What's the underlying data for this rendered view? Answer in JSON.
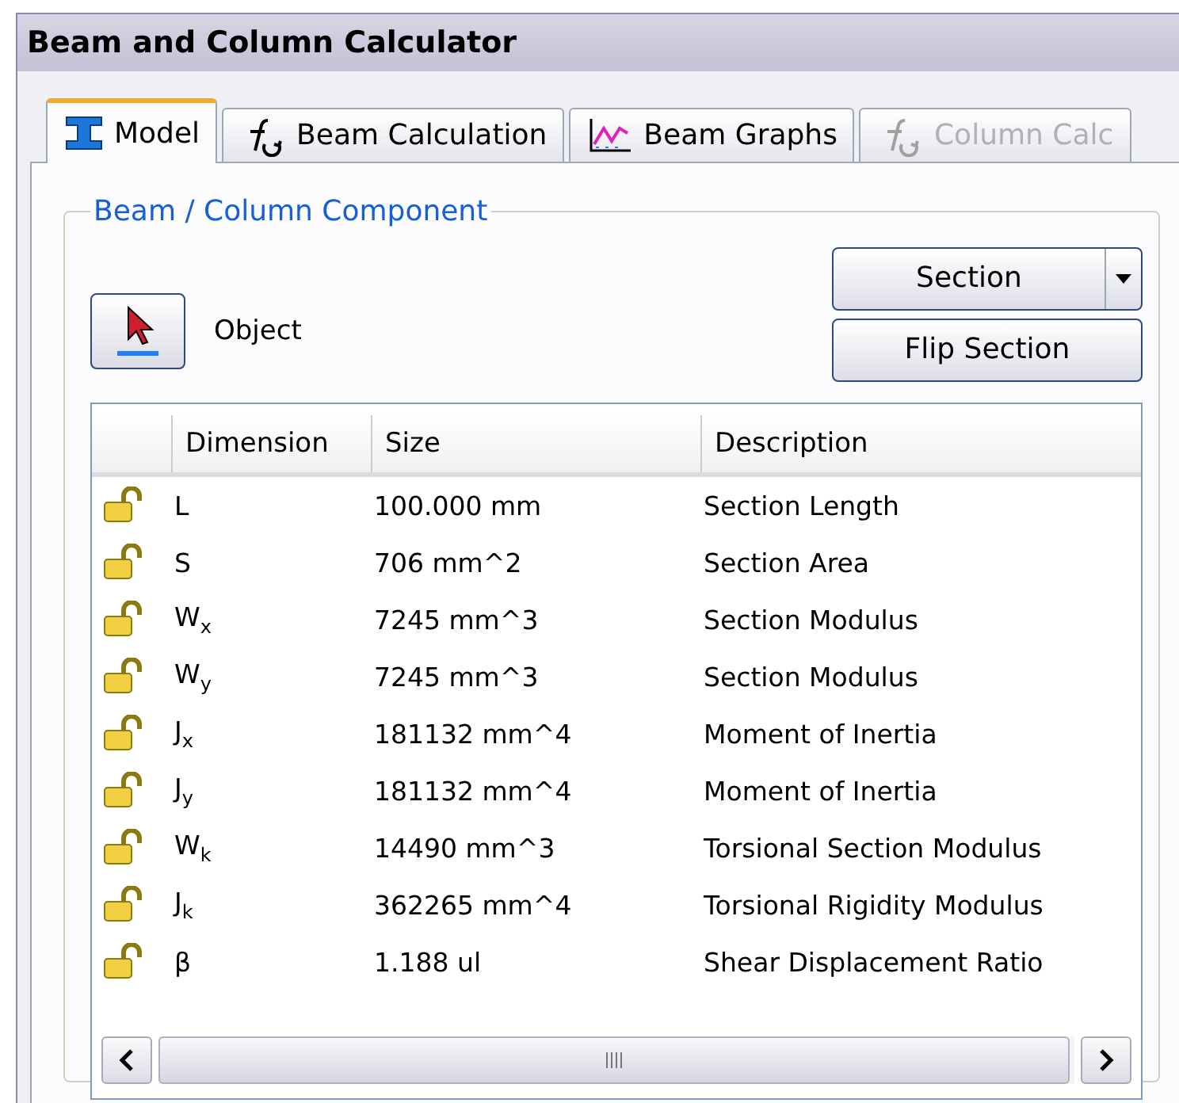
{
  "window": {
    "title": "Beam and Column Calculator"
  },
  "tabs": [
    {
      "label": "Model",
      "kind": "beam",
      "selected": true,
      "disabled": false
    },
    {
      "label": "Beam Calculation",
      "kind": "formula",
      "selected": false,
      "disabled": false
    },
    {
      "label": "Beam Graphs",
      "kind": "graph",
      "selected": false,
      "disabled": false
    },
    {
      "label": "Column Calc",
      "kind": "formula",
      "selected": false,
      "disabled": true
    }
  ],
  "group": {
    "title": "Beam / Column Component",
    "object_button": {
      "label": "Object"
    },
    "section_button": {
      "label": "Section"
    },
    "flip_button": {
      "label": "Flip Section"
    },
    "table": {
      "columns": [
        "Dimension",
        "Size",
        "Description"
      ],
      "rows": [
        {
          "dimension": "L",
          "size": "100.000 mm",
          "description": "Section Length"
        },
        {
          "dimension": "S",
          "size": "706 mm^2",
          "description": "Section Area"
        },
        {
          "dimension": "W$_{x}$",
          "size": "7245 mm^3",
          "description": "Section Modulus"
        },
        {
          "dimension": "W$_{y}$",
          "size": "7245 mm^3",
          "description": "Section Modulus"
        },
        {
          "dimension": "J$_{x}$",
          "size": "181132 mm^4",
          "description": "Moment of Inertia"
        },
        {
          "dimension": "J$_{y}$",
          "size": "181132 mm^4",
          "description": "Moment of Inertia"
        },
        {
          "dimension": "W$_{k}$",
          "size": "14490 mm^3",
          "description": "Torsional Section Modulus"
        },
        {
          "dimension": "J$_{k}$",
          "size": "362265 mm^4",
          "description": "Torsional Rigidity Modulus"
        },
        {
          "dimension": "β",
          "size": "1.188 ul",
          "description": "Shear Displacement Ratio"
        }
      ]
    }
  }
}
